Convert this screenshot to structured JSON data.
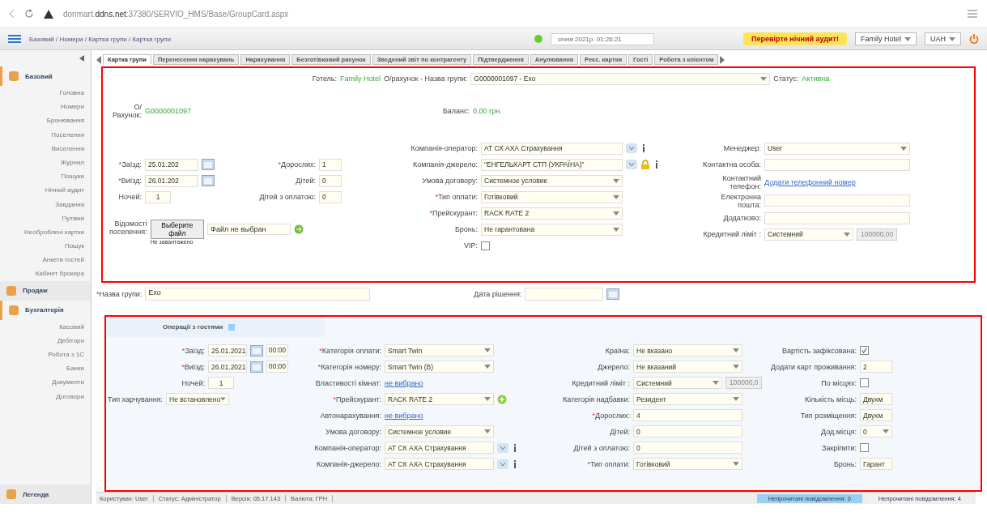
{
  "browser": {
    "url": "donmart.**ddns.net**:37380/SERVIO_HMS/Base/GroupCard.aspx"
  },
  "app_bar": {
    "breadcrumb": "Базовий / Номери / Картка групи / Картка групи",
    "datetime": "січня 2021р. 01:26:21",
    "alert": "Перевірте нічний аудит!",
    "hotel": "Family Hotel",
    "currency": "UAH"
  },
  "sidebar": {
    "sections": [
      {
        "title": "Базовий",
        "expanded": true,
        "items": [
          "Головна",
          "Номери",
          "Бронювання",
          "Поселення",
          "Виселення",
          "Журнал",
          "Пошуки",
          "Нічний аудит",
          "Завдання",
          "Путівки",
          "Необроблені картки",
          "Пошук",
          "Анкети гостей",
          "Кабінет брокера"
        ]
      },
      {
        "title": "Продаж",
        "expanded": false
      },
      {
        "title": "Бухгалтерія",
        "expanded": true,
        "items": [
          "Касовий",
          "Дебітори",
          "Робота з 1С",
          "Банки",
          "Документи",
          "Договори"
        ]
      },
      {
        "title": "Легенда"
      }
    ]
  },
  "tabs": [
    {
      "label": "Картка групи",
      "selected": true
    },
    {
      "label": "Перенесення нарахувань",
      "selected": false
    },
    {
      "label": "Нарахування",
      "selected": false
    },
    {
      "label": "Безготівковий рахунок",
      "selected": false
    },
    {
      "label": "Зведений звіт по контрагенту",
      "selected": false
    },
    {
      "label": "Підтвердження",
      "selected": false
    },
    {
      "label": "Анулювання",
      "selected": false
    },
    {
      "label": "Реєс. картки",
      "selected": false
    },
    {
      "label": "Гості",
      "selected": false
    },
    {
      "label": "Робота з клієнтом",
      "selected": false
    }
  ],
  "group_card": {
    "hotel_label": "Готель:",
    "hotel": "Family Hotel",
    "group_label": "О/рахунок - Назва групи:",
    "group": "G0000001097 - Exo",
    "status_label": "Статус:",
    "status": "Активна",
    "account_label": "О/ Рахунок:",
    "account": "G0000001097",
    "balance_label": "Баланс:",
    "balance": "0,00 грн.",
    "columns": [
      [
        {
          "kind": "date",
          "label": "*Заїзд:",
          "required": true,
          "value": "25.01.202"
        },
        {
          "kind": "date",
          "label": "*Виїзд:",
          "required": true,
          "value": "26.01.202"
        },
        {
          "kind": "number",
          "label": "Ночей:",
          "required": false,
          "value": "1"
        }
      ],
      [
        {
          "kind": "input",
          "label": "*Дорослих:",
          "required": true,
          "value": "1"
        },
        {
          "kind": "input",
          "label": "Дітей:",
          "required": false,
          "value": "0"
        },
        {
          "kind": "input",
          "label": "Дітей з оплатою:",
          "required": false,
          "value": "0"
        }
      ],
      [
        {
          "kind": "lookup",
          "label": "Компанія-оператор:",
          "required": false,
          "value": "АТ СК АХА Страхування"
        },
        {
          "kind": "lookup_locked",
          "label": "Компанія-джерело:",
          "required": false,
          "value": "\"ЕНГЕЛЬХАРТ СТП (УКРАЇНА)\""
        },
        {
          "kind": "select",
          "label": "Умова договору:",
          "required": false,
          "value": "Системное условие"
        },
        {
          "kind": "select",
          "label": "*Тип оплати:",
          "required": true,
          "value": "Готівковий"
        },
        {
          "kind": "select",
          "label": "*Прейскурант:",
          "required": true,
          "value": "RACK RATE 2"
        },
        {
          "kind": "select",
          "label": "Бронь:",
          "required": false,
          "value": "Не гарантована"
        },
        {
          "kind": "checkbox",
          "label": "VIP:",
          "required": false,
          "checked": false
        }
      ],
      [
        {
          "kind": "select",
          "label": "Менеджер:",
          "required": false,
          "value": "User"
        },
        {
          "kind": "input",
          "label": "Контактна особа:",
          "required": false
        },
        {
          "kind": "link",
          "label": "Контактний телефон:",
          "required": false,
          "value": "Додати телефонний номер"
        },
        {
          "kind": "input",
          "label": "Електронна пошта:",
          "required": false
        },
        {
          "kind": "input",
          "label": "Додатково:",
          "required": false
        },
        {
          "kind": "credit",
          "label": "Кредитний ліміт :",
          "required": false,
          "value": "Системний",
          "amount": "100000,00"
        }
      ]
    ],
    "file": {
      "label": "Відомості поселення:",
      "button": "Выберите файл",
      "file_name": "Файл не выбран",
      "note": "Не завантажено"
    },
    "name_label": "*Назва групи:",
    "name": "Exo",
    "decision_label": "Дата рішення:"
  },
  "guest_operations": {
    "tab": "Операції з гостями",
    "columns": [
      [
        {
          "kind": "datetime",
          "label": "*Заїзд:",
          "required": true,
          "value": "25.01.2021",
          "time": "00:00"
        },
        {
          "kind": "datetime",
          "label": "*Виїзд:",
          "required": true,
          "value": "26.01.2021",
          "time": "00:00"
        },
        {
          "kind": "number",
          "label": "Ночей:",
          "required": false,
          "value": "1"
        },
        {
          "kind": "select",
          "label": "Тип харчування:",
          "required": false,
          "value": "Не встановлено"
        }
      ],
      [
        {
          "kind": "select",
          "label": "*Категорія оплати:",
          "required": true,
          "value": "Smart Twin"
        },
        {
          "kind": "select",
          "label": "*Категорія номеру:",
          "required": true,
          "value": "Smart Twin (B)"
        },
        {
          "kind": "link",
          "label": "Властивості кімнат:",
          "required": false,
          "value": "не вибрано"
        },
        {
          "kind": "select_add",
          "label": "*Прейскурант:",
          "required": true,
          "value": "RACK RATE 2"
        },
        {
          "kind": "link",
          "label": "Автонарахування:",
          "required": false,
          "value": "не вибрано"
        },
        {
          "kind": "select",
          "label": "Умова договору:",
          "required": false,
          "value": "Системное условие"
        },
        {
          "kind": "lookup",
          "label": "Компанія-оператор:",
          "required": false,
          "value": "АТ СК АХА Страхування"
        },
        {
          "kind": "lookup",
          "label": "Компанія-джерело:",
          "required": false,
          "value": "АТ СК АХА Страхування"
        }
      ],
      [
        {
          "kind": "select",
          "label": "Країна:",
          "required": false,
          "value": "Не вказано"
        },
        {
          "kind": "select",
          "label": "Джерело:",
          "required": false,
          "value": "Не вказаний"
        },
        {
          "kind": "credit",
          "label": "Кредитний ліміт :",
          "required": false,
          "value": "Системний",
          "amount": "100000,0"
        },
        {
          "kind": "select",
          "label": "Категорія надбавки:",
          "required": false,
          "value": "Резидент"
        },
        {
          "kind": "input",
          "label": "*Дорослих:",
          "required": true,
          "value": "4"
        },
        {
          "kind": "input",
          "label": "Дітей:",
          "required": false,
          "value": "0"
        },
        {
          "kind": "input",
          "label": "Дітей з оплатою:",
          "required": false,
          "value": "0"
        },
        {
          "kind": "select",
          "label": "*Тип оплати:",
          "required": true,
          "value": "Готівковий"
        }
      ],
      [
        {
          "kind": "checkbox",
          "label": "Вартість зафіксована:",
          "required": false,
          "checked": true
        },
        {
          "kind": "input",
          "label": "Додати карт проживання:",
          "required": false,
          "value": "2"
        },
        {
          "kind": "checkbox",
          "label": "По місцях:",
          "required": false,
          "checked": false
        },
        {
          "kind": "input",
          "label": "Кількість місць:",
          "required": false,
          "value": "Двухм"
        },
        {
          "kind": "input",
          "label": "Тип розміщення:",
          "required": false,
          "value": "Двухм"
        },
        {
          "kind": "select",
          "label": "Дод.місця:",
          "required": false,
          "value": "0"
        },
        {
          "kind": "checkbox",
          "label": "Закріпити:",
          "required": false,
          "checked": false
        },
        {
          "kind": "input",
          "label": "Бронь:",
          "required": false,
          "value": "Гарант"
        }
      ]
    ]
  },
  "status_bar": {
    "items": [
      "Користувач: User",
      "Статус: Адміністратор",
      "Версія: 05.17.143",
      "Валюта: ГРН"
    ],
    "messages": [
      {
        "text": "Непрочитані повідомлення: 0",
        "selected": true
      },
      {
        "text": "Непрочитані повідомлення: 4",
        "selected": false
      }
    ]
  }
}
